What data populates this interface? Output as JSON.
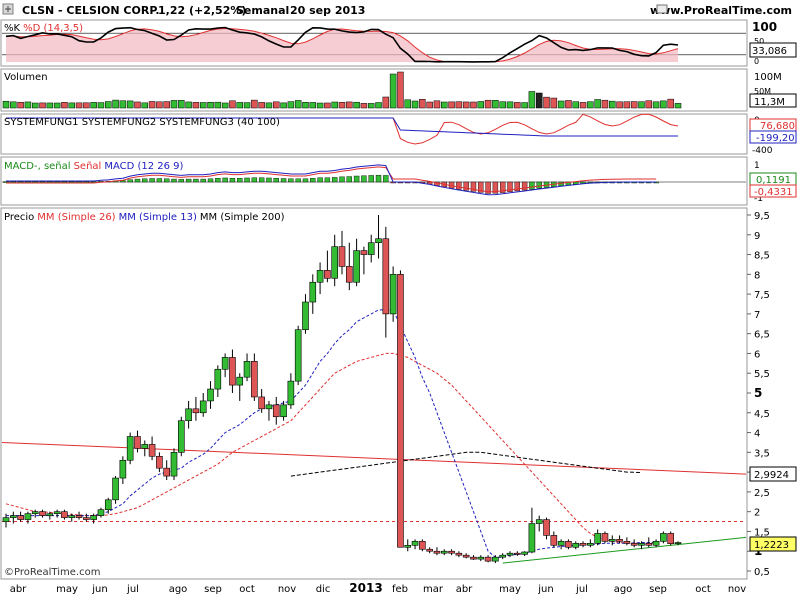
{
  "header": {
    "symbol": "CLSN - CELSION CORP.",
    "quote": "1,22 (+2,52%)",
    "period": "Semanal",
    "date": "20 sep 2013",
    "site": "www.ProRealTime.com"
  },
  "watermark": "©ProRealTime.com",
  "x_axis": {
    "labels": [
      "abr",
      "may",
      "jun",
      "jul",
      "ago",
      "sep",
      "oct",
      "nov",
      "dic",
      "2013",
      "feb",
      "mar",
      "abr",
      "may",
      "jun",
      "jul",
      "ago",
      "sep",
      "oct",
      "nov"
    ]
  },
  "panels": {
    "stoch": {
      "legend": [
        "%K",
        "%D (14,3,5)"
      ],
      "legend_colors": [
        "#000000",
        "#e03030"
      ],
      "ticks": [
        "100",
        "50",
        "0"
      ],
      "last_value": "33,086"
    },
    "volume": {
      "legend": "Volumen",
      "ticks": [
        "100M",
        "50M",
        "0"
      ],
      "last_value": "11,3M"
    },
    "sysfung": {
      "legend": "SYSTEMFUNG1 SYSTEMFUNG2 SYSTEMFUNG3 (40 100)",
      "ticks": [
        "0",
        "-400"
      ],
      "values": [
        "76,680",
        "-199,20"
      ]
    },
    "macd": {
      "legend_parts": [
        "MACD-, señal",
        "Señal",
        "MACD (12 26 9)"
      ],
      "legend_colors": [
        "#000000",
        "#e03030",
        "#2020c0"
      ],
      "ticks": [
        "1",
        "0",
        "-1"
      ],
      "values": [
        "0,1191",
        "-0,4331"
      ]
    },
    "price": {
      "legend_parts": [
        "Precio",
        "MM (Simple 26)",
        "MM (Simple 13)",
        "MM (Simple 200)"
      ],
      "legend_colors": [
        "#000000",
        "#e03030",
        "#2020c0",
        "#000000"
      ],
      "ticks": [
        "9,5",
        "9",
        "8,5",
        "8",
        "7,5",
        "7",
        "6,5",
        "6",
        "5,5",
        "5",
        "4,5",
        "4",
        "3,5",
        "3",
        "2,5",
        "2",
        "1,5",
        "1",
        "0,5"
      ],
      "value_labels": [
        "2,9924",
        "1,2223"
      ],
      "last_price": "1,22"
    }
  },
  "chart_data": {
    "type": "candlestick",
    "title": "CLSN - CELSION CORP.",
    "period": "Semanal",
    "x_range": [
      "2012-04",
      "2013-11"
    ],
    "y_range": [
      0.5,
      9.8
    ],
    "candles": [
      {
        "o": 1.75,
        "h": 1.95,
        "l": 1.6,
        "c": 1.85
      },
      {
        "o": 1.85,
        "h": 2.0,
        "l": 1.7,
        "c": 1.9
      },
      {
        "o": 1.9,
        "h": 2.0,
        "l": 1.75,
        "c": 1.8
      },
      {
        "o": 1.8,
        "h": 2.0,
        "l": 1.7,
        "c": 1.95
      },
      {
        "o": 1.95,
        "h": 2.05,
        "l": 1.85,
        "c": 2.0
      },
      {
        "o": 2.0,
        "h": 2.05,
        "l": 1.85,
        "c": 1.9
      },
      {
        "o": 1.9,
        "h": 2.0,
        "l": 1.8,
        "c": 1.95
      },
      {
        "o": 1.95,
        "h": 2.05,
        "l": 1.85,
        "c": 2.0
      },
      {
        "o": 2.0,
        "h": 2.05,
        "l": 1.8,
        "c": 1.85
      },
      {
        "o": 1.85,
        "h": 1.95,
        "l": 1.75,
        "c": 1.9
      },
      {
        "o": 1.9,
        "h": 2.0,
        "l": 1.8,
        "c": 1.85
      },
      {
        "o": 1.85,
        "h": 1.95,
        "l": 1.75,
        "c": 1.8
      },
      {
        "o": 1.8,
        "h": 1.95,
        "l": 1.7,
        "c": 1.9
      },
      {
        "o": 1.9,
        "h": 2.1,
        "l": 1.85,
        "c": 2.05
      },
      {
        "o": 2.05,
        "h": 2.35,
        "l": 1.95,
        "c": 2.3
      },
      {
        "o": 2.3,
        "h": 2.9,
        "l": 2.2,
        "c": 2.85
      },
      {
        "o": 2.85,
        "h": 3.4,
        "l": 2.7,
        "c": 3.3
      },
      {
        "o": 3.3,
        "h": 4.0,
        "l": 3.2,
        "c": 3.9
      },
      {
        "o": 3.9,
        "h": 4.05,
        "l": 3.5,
        "c": 3.6
      },
      {
        "o": 3.6,
        "h": 3.8,
        "l": 3.4,
        "c": 3.7
      },
      {
        "o": 3.7,
        "h": 3.9,
        "l": 3.3,
        "c": 3.4
      },
      {
        "o": 3.4,
        "h": 3.5,
        "l": 3.0,
        "c": 3.1
      },
      {
        "o": 3.1,
        "h": 3.3,
        "l": 2.8,
        "c": 2.9
      },
      {
        "o": 2.9,
        "h": 3.6,
        "l": 2.8,
        "c": 3.5
      },
      {
        "o": 3.5,
        "h": 4.4,
        "l": 3.4,
        "c": 4.3
      },
      {
        "o": 4.3,
        "h": 4.8,
        "l": 4.1,
        "c": 4.6
      },
      {
        "o": 4.6,
        "h": 4.9,
        "l": 4.3,
        "c": 4.5
      },
      {
        "o": 4.5,
        "h": 5.0,
        "l": 4.4,
        "c": 4.8
      },
      {
        "o": 4.8,
        "h": 5.3,
        "l": 4.6,
        "c": 5.1
      },
      {
        "o": 5.1,
        "h": 5.7,
        "l": 4.9,
        "c": 5.6
      },
      {
        "o": 5.6,
        "h": 6.0,
        "l": 5.4,
        "c": 5.9
      },
      {
        "o": 5.9,
        "h": 6.1,
        "l": 5.0,
        "c": 5.2
      },
      {
        "o": 5.2,
        "h": 5.5,
        "l": 4.8,
        "c": 5.4
      },
      {
        "o": 5.4,
        "h": 6.0,
        "l": 5.3,
        "c": 5.8
      },
      {
        "o": 5.8,
        "h": 6.0,
        "l": 4.8,
        "c": 4.9
      },
      {
        "o": 4.9,
        "h": 5.1,
        "l": 4.5,
        "c": 4.6
      },
      {
        "o": 4.6,
        "h": 4.8,
        "l": 4.3,
        "c": 4.7
      },
      {
        "o": 4.7,
        "h": 4.9,
        "l": 4.2,
        "c": 4.4
      },
      {
        "o": 4.4,
        "h": 4.8,
        "l": 4.3,
        "c": 4.7
      },
      {
        "o": 4.7,
        "h": 5.5,
        "l": 4.6,
        "c": 5.3
      },
      {
        "o": 5.3,
        "h": 6.7,
        "l": 5.2,
        "c": 6.6
      },
      {
        "o": 6.6,
        "h": 7.5,
        "l": 6.5,
        "c": 7.3
      },
      {
        "o": 7.3,
        "h": 8.0,
        "l": 7.0,
        "c": 7.8
      },
      {
        "o": 7.8,
        "h": 8.3,
        "l": 7.5,
        "c": 8.1
      },
      {
        "o": 8.1,
        "h": 8.6,
        "l": 7.8,
        "c": 7.9
      },
      {
        "o": 7.9,
        "h": 9.0,
        "l": 7.7,
        "c": 8.7
      },
      {
        "o": 8.7,
        "h": 9.1,
        "l": 8.0,
        "c": 8.2
      },
      {
        "o": 8.2,
        "h": 8.8,
        "l": 7.6,
        "c": 7.8
      },
      {
        "o": 7.8,
        "h": 8.9,
        "l": 7.7,
        "c": 8.6
      },
      {
        "o": 8.6,
        "h": 8.7,
        "l": 8.0,
        "c": 8.5
      },
      {
        "o": 8.5,
        "h": 9.0,
        "l": 8.3,
        "c": 8.8
      },
      {
        "o": 8.8,
        "h": 9.5,
        "l": 8.4,
        "c": 8.9
      },
      {
        "o": 8.9,
        "h": 9.2,
        "l": 6.4,
        "c": 7.0
      },
      {
        "o": 7.0,
        "h": 8.2,
        "l": 6.8,
        "c": 8.0
      },
      {
        "o": 8.0,
        "h": 8.1,
        "l": 1.1,
        "c": 1.1
      },
      {
        "o": 1.1,
        "h": 1.3,
        "l": 1.0,
        "c": 1.15
      },
      {
        "o": 1.15,
        "h": 1.3,
        "l": 1.05,
        "c": 1.25
      },
      {
        "o": 1.25,
        "h": 1.3,
        "l": 1.0,
        "c": 1.05
      },
      {
        "o": 1.05,
        "h": 1.1,
        "l": 0.95,
        "c": 1.0
      },
      {
        "o": 1.0,
        "h": 1.1,
        "l": 0.9,
        "c": 0.95
      },
      {
        "o": 0.95,
        "h": 1.05,
        "l": 0.9,
        "c": 1.0
      },
      {
        "o": 1.0,
        "h": 1.05,
        "l": 0.9,
        "c": 0.95
      },
      {
        "o": 0.95,
        "h": 1.0,
        "l": 0.85,
        "c": 0.9
      },
      {
        "o": 0.9,
        "h": 0.95,
        "l": 0.82,
        "c": 0.85
      },
      {
        "o": 0.85,
        "h": 0.9,
        "l": 0.78,
        "c": 0.8
      },
      {
        "o": 0.8,
        "h": 0.9,
        "l": 0.75,
        "c": 0.85
      },
      {
        "o": 0.85,
        "h": 0.9,
        "l": 0.72,
        "c": 0.75
      },
      {
        "o": 0.75,
        "h": 0.9,
        "l": 0.7,
        "c": 0.85
      },
      {
        "o": 0.85,
        "h": 0.95,
        "l": 0.8,
        "c": 0.9
      },
      {
        "o": 0.9,
        "h": 1.0,
        "l": 0.85,
        "c": 0.95
      },
      {
        "o": 0.95,
        "h": 1.0,
        "l": 0.88,
        "c": 0.92
      },
      {
        "o": 0.92,
        "h": 1.0,
        "l": 0.88,
        "c": 0.98
      },
      {
        "o": 0.98,
        "h": 2.1,
        "l": 0.95,
        "c": 1.7
      },
      {
        "o": 1.7,
        "h": 1.9,
        "l": 1.5,
        "c": 1.8
      },
      {
        "o": 1.8,
        "h": 1.85,
        "l": 1.3,
        "c": 1.4
      },
      {
        "o": 1.4,
        "h": 1.5,
        "l": 1.1,
        "c": 1.15
      },
      {
        "o": 1.15,
        "h": 1.3,
        "l": 1.05,
        "c": 1.25
      },
      {
        "o": 1.25,
        "h": 1.3,
        "l": 1.05,
        "c": 1.1
      },
      {
        "o": 1.1,
        "h": 1.25,
        "l": 1.05,
        "c": 1.2
      },
      {
        "o": 1.2,
        "h": 1.25,
        "l": 1.1,
        "c": 1.15
      },
      {
        "o": 1.15,
        "h": 1.3,
        "l": 1.1,
        "c": 1.2
      },
      {
        "o": 1.2,
        "h": 1.55,
        "l": 1.15,
        "c": 1.45
      },
      {
        "o": 1.45,
        "h": 1.5,
        "l": 1.2,
        "c": 1.25
      },
      {
        "o": 1.25,
        "h": 1.4,
        "l": 1.15,
        "c": 1.3
      },
      {
        "o": 1.3,
        "h": 1.4,
        "l": 1.2,
        "c": 1.25
      },
      {
        "o": 1.25,
        "h": 1.35,
        "l": 1.15,
        "c": 1.2
      },
      {
        "o": 1.2,
        "h": 1.3,
        "l": 1.1,
        "c": 1.15
      },
      {
        "o": 1.15,
        "h": 1.25,
        "l": 1.05,
        "c": 1.2
      },
      {
        "o": 1.2,
        "h": 1.35,
        "l": 1.1,
        "c": 1.15
      },
      {
        "o": 1.15,
        "h": 1.3,
        "l": 1.1,
        "c": 1.25
      },
      {
        "o": 1.25,
        "h": 1.5,
        "l": 1.2,
        "c": 1.45
      },
      {
        "o": 1.45,
        "h": 1.5,
        "l": 1.15,
        "c": 1.19
      },
      {
        "o": 1.19,
        "h": 1.25,
        "l": 1.15,
        "c": 1.22
      }
    ],
    "ma13": [
      1.9,
      1.9,
      1.9,
      1.9,
      1.9,
      1.9,
      1.9,
      1.9,
      1.9,
      1.9,
      1.9,
      1.9,
      1.9,
      1.95,
      2.0,
      2.1,
      2.2,
      2.4,
      2.55,
      2.7,
      2.85,
      2.95,
      3.0,
      3.05,
      3.1,
      3.25,
      3.35,
      3.45,
      3.6,
      3.8,
      4.0,
      4.1,
      4.2,
      4.35,
      4.5,
      4.6,
      4.65,
      4.7,
      4.75,
      4.8,
      5.0,
      5.2,
      5.5,
      5.8,
      6.0,
      6.25,
      6.45,
      6.6,
      6.8,
      6.9,
      7.0,
      7.1,
      7.1,
      7.1,
      6.7,
      6.3,
      5.9,
      5.4,
      5.0,
      4.5,
      4.0,
      3.5,
      3.0,
      2.5,
      2.0,
      1.5,
      1.0,
      0.85,
      0.85,
      0.9,
      0.92,
      0.95,
      1.0,
      1.05,
      1.08,
      1.1,
      1.12,
      1.14,
      1.15,
      1.16,
      1.17,
      1.18,
      1.2,
      1.2,
      1.2,
      1.2,
      1.21,
      1.22,
      1.22,
      1.22
    ],
    "ma26": [
      2.2,
      2.15,
      2.1,
      2.05,
      2.0,
      2.0,
      1.98,
      1.96,
      1.95,
      1.93,
      1.92,
      1.9,
      1.9,
      1.9,
      1.92,
      1.95,
      2.0,
      2.05,
      2.1,
      2.2,
      2.3,
      2.4,
      2.5,
      2.6,
      2.7,
      2.8,
      2.9,
      3.0,
      3.1,
      3.2,
      3.35,
      3.5,
      3.6,
      3.7,
      3.8,
      3.9,
      4.0,
      4.1,
      4.2,
      4.3,
      4.5,
      4.7,
      4.9,
      5.1,
      5.3,
      5.5,
      5.6,
      5.7,
      5.8,
      5.85,
      5.9,
      5.95,
      6.0,
      6.0,
      5.95,
      5.9,
      5.8,
      5.7,
      5.6,
      5.5,
      5.35,
      5.2,
      5.0,
      4.8,
      4.6,
      4.4,
      4.2,
      4.0,
      3.8,
      3.6,
      3.4,
      3.2,
      3.0,
      2.8,
      2.6,
      2.4,
      2.2,
      2.0,
      1.8,
      1.6,
      1.45,
      1.35,
      1.3,
      1.25,
      1.22,
      1.2,
      1.2,
      1.2,
      1.2,
      1.2
    ],
    "ma200": [
      2.9,
      2.95,
      3.0,
      3.05,
      3.1,
      3.15,
      3.2,
      3.25,
      3.3,
      3.35,
      3.4,
      3.45,
      3.5,
      3.5,
      3.45,
      3.4,
      3.35,
      3.3,
      3.25,
      3.2,
      3.15,
      3.1,
      3.05,
      3.0,
      2.99
    ],
    "resistance_line": {
      "from": 3.75,
      "to": 2.95
    },
    "support_line": {
      "from": 0.7,
      "to": 1.35
    },
    "horizontal_line": 1.75
  }
}
